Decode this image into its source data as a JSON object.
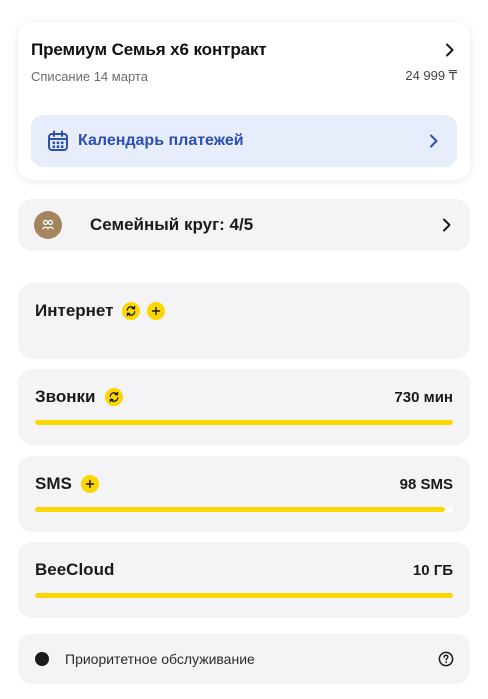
{
  "tariff": {
    "title": "Премиум Семья х6 контракт",
    "charge_date": "Списание 14 марта",
    "price": "24 999 ₸",
    "calendar_label": "Календарь платежей"
  },
  "family": {
    "label": "Семейный круг: 4/5"
  },
  "services": {
    "internet": {
      "name": "Интернет"
    },
    "calls": {
      "name": "Звонки",
      "value": "730 мин",
      "fill_fraction": 1.0
    },
    "sms": {
      "name": "SMS",
      "value": "98 SMS",
      "fill_fraction": 0.98
    },
    "cloud": {
      "name": "BeeCloud",
      "value": "10 ГБ",
      "fill_fraction": 1.0
    }
  },
  "priority": {
    "label": "Приоритетное обслуживание"
  },
  "colors": {
    "accent_yellow": "#fcd600",
    "link_blue": "#2b4fb5",
    "calendar_bg": "#e8edfb",
    "card_bg": "#f4f4f6",
    "avatar_brown": "#a3845b"
  },
  "icons": {
    "tariff_chevron": "chevron-right-icon",
    "calendar": "calendar-icon",
    "family_avatar": "family-icon",
    "refresh": "refresh-icon",
    "add": "plus-icon",
    "help": "question-circle-icon"
  }
}
